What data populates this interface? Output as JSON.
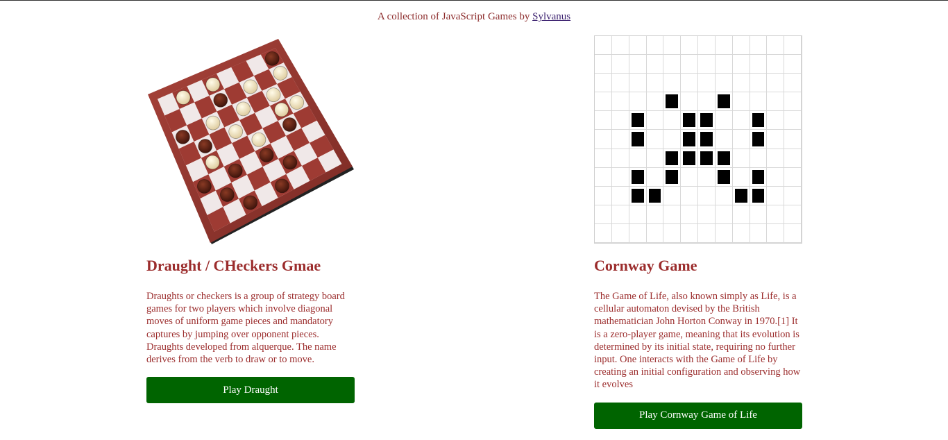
{
  "header": {
    "text": "A collection of JavaScript Games by",
    "author_link": "Sylvanus"
  },
  "games": [
    {
      "title": "Draught / CHeckers Gmae",
      "description": "Draughts or checkers is a group of strategy board games for two players which involve diagonal moves of uniform game pieces and mandatory captures by jumping over opponent pieces. Draughts developed from alquerque. The name derives from the verb to draw or to move.",
      "button_label": "Play Draught",
      "image": "checkers-board-image"
    },
    {
      "title": "Cornway Game",
      "description": "The Game of Life, also known simply as Life, is a cellular automaton devised by the British mathematician John Horton Conway in 1970.[1] It is a zero-player game, meaning that its evolution is determined by its initial state, requiring no further input. One interacts with the Game of Life by creating an initial configuration and observing how it evolves",
      "button_label": "Play Cornway Game of Life",
      "grid": {
        "cols": 12,
        "rows": 11,
        "live_cells": [
          [
            3,
            4
          ],
          [
            3,
            7
          ],
          [
            4,
            2
          ],
          [
            4,
            5
          ],
          [
            4,
            6
          ],
          [
            4,
            9
          ],
          [
            5,
            2
          ],
          [
            5,
            5
          ],
          [
            5,
            6
          ],
          [
            5,
            9
          ],
          [
            6,
            4
          ],
          [
            6,
            5
          ],
          [
            6,
            6
          ],
          [
            6,
            7
          ],
          [
            7,
            2
          ],
          [
            7,
            4
          ],
          [
            7,
            7
          ],
          [
            7,
            9
          ],
          [
            8,
            2
          ],
          [
            8,
            3
          ],
          [
            8,
            8
          ],
          [
            8,
            9
          ]
        ]
      }
    }
  ],
  "colors": {
    "text": "#9b2c2c",
    "link": "#3a1f6e",
    "button": "#006400"
  }
}
